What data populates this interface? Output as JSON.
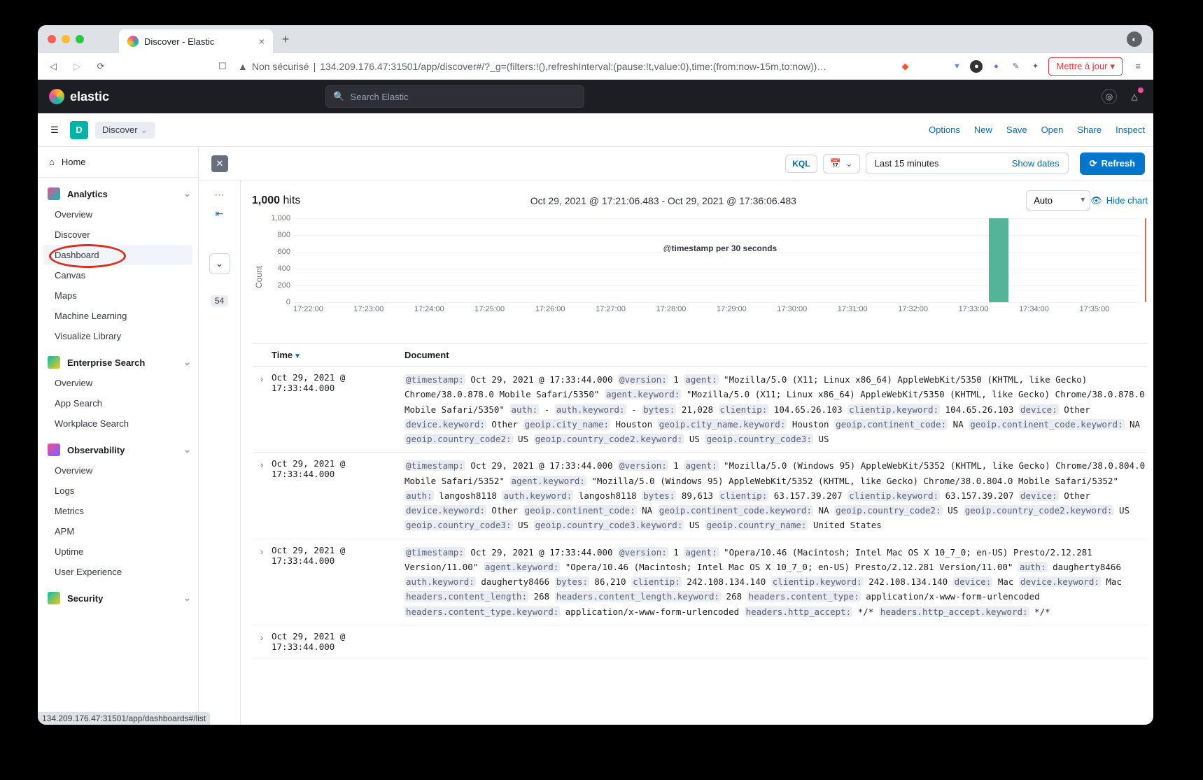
{
  "browser": {
    "tab_title": "Discover - Elastic",
    "url_label": "Non sécurisé",
    "url": "134.209.176.47:31501/app/discover#/?_g=(filters:!(),refreshInterval:(pause:!t,value:0),time:(from:now-15m,to:now))…",
    "update_btn": "Mettre à jour",
    "status_url": "134.209.176.47:31501/app/dashboards#/list"
  },
  "elasticHeader": {
    "brand": "elastic",
    "search_placeholder": "Search Elastic"
  },
  "subheader": {
    "space_letter": "D",
    "crumb": "Discover",
    "links": [
      "Options",
      "New",
      "Save",
      "Open",
      "Share",
      "Inspect"
    ]
  },
  "querybar": {
    "kql": "KQL",
    "time_label": "Last 15 minutes",
    "show_dates": "Show dates",
    "refresh": "Refresh"
  },
  "sidebar": {
    "home": "Home",
    "groups": [
      {
        "title": "Analytics",
        "icon_color1": "#f04e98",
        "icon_color2": "#00bfb3",
        "items": [
          "Overview",
          "Discover",
          "Dashboard",
          "Canvas",
          "Maps",
          "Machine Learning",
          "Visualize Library"
        ],
        "highlight_index": 2,
        "hover_index": 2,
        "active_bg_index": 1
      },
      {
        "title": "Enterprise Search",
        "icon_color1": "#00bfb3",
        "icon_color2": "#fec514",
        "items": [
          "Overview",
          "App Search",
          "Workplace Search"
        ]
      },
      {
        "title": "Observability",
        "icon_color1": "#f04e98",
        "icon_color2": "#7b61ff",
        "items": [
          "Overview",
          "Logs",
          "Metrics",
          "APM",
          "Uptime",
          "User Experience"
        ]
      },
      {
        "title": "Security",
        "icon_color1": "#00bfb3",
        "icon_color2": "#fec514",
        "items": []
      }
    ]
  },
  "gutter": {
    "badge": "54"
  },
  "hits": {
    "count": "1,000",
    "word": "hits",
    "range": "Oct 29, 2021 @ 17:21:06.483 - Oct 29, 2021 @ 17:36:06.483",
    "interval": "Auto",
    "hide_chart": "Hide chart"
  },
  "chart_data": {
    "type": "bar",
    "title": "",
    "xlabel": "@timestamp per 30 seconds",
    "ylabel": "Count",
    "ylim": [
      0,
      1000
    ],
    "yticks": [
      0,
      200,
      400,
      600,
      800,
      1000
    ],
    "xticks": [
      "17:22:00",
      "17:23:00",
      "17:24:00",
      "17:25:00",
      "17:26:00",
      "17:27:00",
      "17:28:00",
      "17:29:00",
      "17:30:00",
      "17:31:00",
      "17:32:00",
      "17:33:00",
      "17:34:00",
      "17:35:00"
    ],
    "bars": [
      {
        "x": "17:33:30",
        "value": 1000
      }
    ],
    "marker_x": "17:36:06"
  },
  "table": {
    "cols": [
      "Time",
      "Document"
    ],
    "rows": [
      {
        "time": "Oct 29, 2021 @ 17:33:44.000",
        "fields": [
          [
            "@timestamp:",
            "Oct 29, 2021 @ 17:33:44.000"
          ],
          [
            "@version:",
            "1"
          ],
          [
            "agent:",
            "\"Mozilla/5.0 (X11; Linux x86_64) AppleWebKit/5350 (KHTML, like Gecko) Chrome/38.0.878.0 Mobile Safari/5350\""
          ],
          [
            "agent.keyword:",
            "\"Mozilla/5.0 (X11; Linux x86_64) AppleWebKit/5350 (KHTML, like Gecko) Chrome/38.0.878.0 Mobile Safari/5350\""
          ],
          [
            "auth:",
            "-"
          ],
          [
            "auth.keyword:",
            "-"
          ],
          [
            "bytes:",
            "21,028"
          ],
          [
            "clientip:",
            "104.65.26.103"
          ],
          [
            "clientip.keyword:",
            "104.65.26.103"
          ],
          [
            "device:",
            "Other"
          ],
          [
            "device.keyword:",
            "Other"
          ],
          [
            "geoip.city_name:",
            "Houston"
          ],
          [
            "geoip.city_name.keyword:",
            "Houston"
          ],
          [
            "geoip.continent_code:",
            "NA"
          ],
          [
            "geoip.continent_code.keyword:",
            "NA"
          ],
          [
            "geoip.country_code2:",
            "US"
          ],
          [
            "geoip.country_code2.keyword:",
            "US"
          ],
          [
            "geoip.country_code3:",
            "US"
          ]
        ]
      },
      {
        "time": "Oct 29, 2021 @ 17:33:44.000",
        "fields": [
          [
            "@timestamp:",
            "Oct 29, 2021 @ 17:33:44.000"
          ],
          [
            "@version:",
            "1"
          ],
          [
            "agent:",
            "\"Mozilla/5.0 (Windows 95) AppleWebKit/5352 (KHTML, like Gecko) Chrome/38.0.804.0 Mobile Safari/5352\""
          ],
          [
            "agent.keyword:",
            "\"Mozilla/5.0 (Windows 95) AppleWebKit/5352 (KHTML, like Gecko) Chrome/38.0.804.0 Mobile Safari/5352\""
          ],
          [
            "auth:",
            "langosh8118"
          ],
          [
            "auth.keyword:",
            "langosh8118"
          ],
          [
            "bytes:",
            "89,613"
          ],
          [
            "clientip:",
            "63.157.39.207"
          ],
          [
            "clientip.keyword:",
            "63.157.39.207"
          ],
          [
            "device:",
            "Other"
          ],
          [
            "device.keyword:",
            "Other"
          ],
          [
            "geoip.continent_code:",
            "NA"
          ],
          [
            "geoip.continent_code.keyword:",
            "NA"
          ],
          [
            "geoip.country_code2:",
            "US"
          ],
          [
            "geoip.country_code2.keyword:",
            "US"
          ],
          [
            "geoip.country_code3:",
            "US"
          ],
          [
            "geoip.country_code3.keyword:",
            "US"
          ],
          [
            "geoip.country_name:",
            "United States"
          ]
        ]
      },
      {
        "time": "Oct 29, 2021 @ 17:33:44.000",
        "fields": [
          [
            "@timestamp:",
            "Oct 29, 2021 @ 17:33:44.000"
          ],
          [
            "@version:",
            "1"
          ],
          [
            "agent:",
            "\"Opera/10.46 (Macintosh; Intel Mac OS X 10_7_0; en-US) Presto/2.12.281 Version/11.00\""
          ],
          [
            "agent.keyword:",
            "\"Opera/10.46 (Macintosh; Intel Mac OS X 10_7_0; en-US) Presto/2.12.281 Version/11.00\""
          ],
          [
            "auth:",
            "daugherty8466"
          ],
          [
            "auth.keyword:",
            "daugherty8466"
          ],
          [
            "bytes:",
            "86,210"
          ],
          [
            "clientip:",
            "242.108.134.140"
          ],
          [
            "clientip.keyword:",
            "242.108.134.140"
          ],
          [
            "device:",
            "Mac"
          ],
          [
            "device.keyword:",
            "Mac"
          ],
          [
            "headers.content_length:",
            "268"
          ],
          [
            "headers.content_length.keyword:",
            "268"
          ],
          [
            "headers.content_type:",
            "application/x-www-form-urlencoded"
          ],
          [
            "headers.content_type.keyword:",
            "application/x-www-form-urlencoded"
          ],
          [
            "headers.http_accept:",
            "*/*"
          ],
          [
            "headers.http_accept.keyword:",
            "*/*"
          ]
        ]
      },
      {
        "time": "Oct 29, 2021 @ 17:33:44.000",
        "fields": []
      }
    ]
  }
}
